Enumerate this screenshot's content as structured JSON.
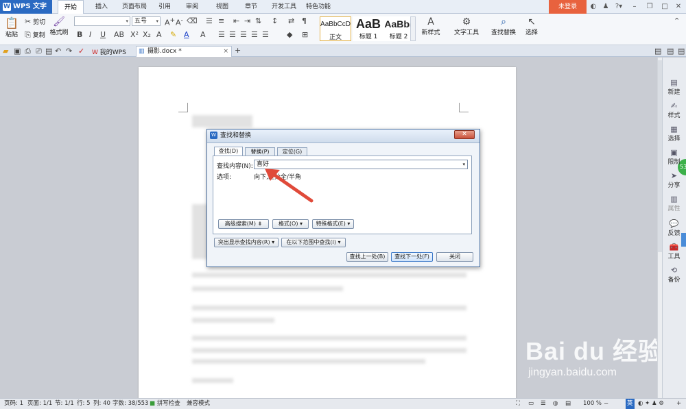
{
  "app": {
    "logo_text": "WPS 文字",
    "menu_tabs": [
      "开始",
      "插入",
      "页面布局",
      "引用",
      "审阅",
      "视图",
      "章节",
      "开发工具",
      "特色功能"
    ],
    "login": "未登录"
  },
  "ribbon": {
    "paste": "粘贴",
    "cut": "剪切",
    "copy": "复制",
    "format_painter": "格式刷",
    "font_size": "五号",
    "styles": [
      {
        "preview": "AaBbCcD",
        "label": "正文"
      },
      {
        "preview": "AaB",
        "label": "标题 1"
      },
      {
        "preview": "AaBb(",
        "label": "标题 2"
      }
    ],
    "new_style": "新样式",
    "text_tool": "文字工具",
    "find_replace": "查找替换",
    "select": "选择"
  },
  "doc_tabs": {
    "my_wps": "我的WPS",
    "doc": "摄影.docx *"
  },
  "side_panel": [
    "新建",
    "样式",
    "选择",
    "限制",
    "分享",
    "属性",
    "反馈",
    "工具",
    "备份"
  ],
  "side_badge": "53",
  "dialog": {
    "title": "查找和替换",
    "tabs": [
      "查找(D)",
      "替换(P)",
      "定位(G)"
    ],
    "find_label": "查找内容(N):",
    "find_value": "喜好",
    "options_label": "选项:",
    "options_value": "向下,区分全/半角",
    "btn_advanced": "高级搜索(M) ⇟",
    "btn_format": "格式(O) ▾",
    "btn_special": "特殊格式(E) ▾",
    "btn_highlight": "突出显示查找内容(R) ▾",
    "btn_range": "在以下范围中查找(I) ▾",
    "btn_prev": "查找上一处(B)",
    "btn_next": "查找下一处(F)",
    "btn_close": "关闭"
  },
  "status": {
    "page": "页码: 1",
    "pages": "页面: 1/1",
    "section": "节: 1/1",
    "line": "行: 5",
    "col": "列: 40",
    "words": "字数: 38/553",
    "spell": "拼写检查",
    "compat": "兼容模式",
    "zoom": "100 %",
    "ime": "英"
  },
  "watermark": {
    "brand": "Bai du 经验",
    "url": "jingyan.baidu.com"
  }
}
